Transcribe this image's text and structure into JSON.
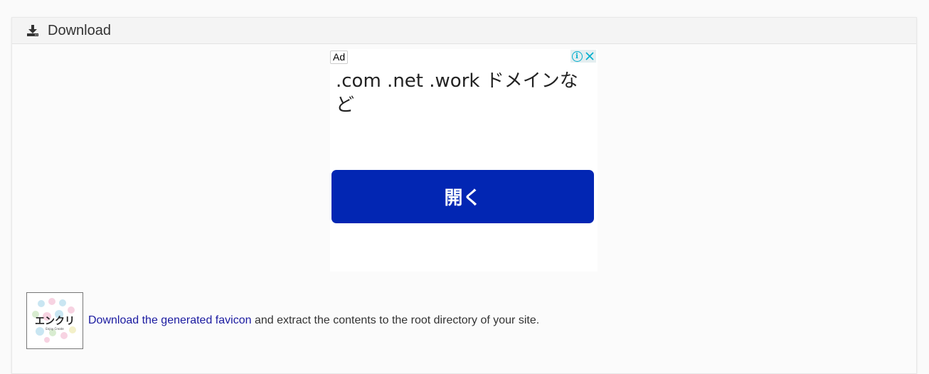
{
  "header": {
    "title": "Download",
    "icon": "download-icon"
  },
  "ad": {
    "badge": "Ad",
    "headline": ".com .net .work ドメインなど",
    "button_label": "開く",
    "button_color": "#0226b3",
    "info_icon": "info-icon",
    "close_icon": "close-icon"
  },
  "favicon": {
    "thumbnail_text": "エンクリ",
    "thumbnail_subtext": "Enjoy Create",
    "link_text": "Download the generated favicon",
    "rest_text": " and extract the contents to the root directory of your site."
  }
}
